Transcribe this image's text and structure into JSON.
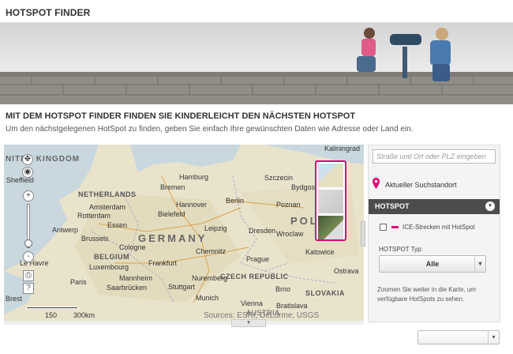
{
  "page": {
    "title": "HOTSPOT FINDER",
    "heading": "MIT DEM HOTSPOT FINDER FINDEN SIE KINDERLEICHT DEN NÄCHSTEN HOTSPOT",
    "subheading": "Um den nächstgelegenen HotSpot zu finden, geben Sie einfach Ihre gewünschten Daten wie Adresse oder Land ein."
  },
  "map": {
    "countries": [
      "NITED KINGDOM",
      "NETHERLANDS",
      "GERMANY",
      "POLA",
      "BELGIUM",
      "CZECH REPUBLIC",
      "SLOVAKIA",
      "AUSTRIA"
    ],
    "cities": [
      "Kaliningrad",
      "Hamburg",
      "Szczecin",
      "Bydgoszcz",
      "Bremen",
      "Berlin",
      "Poznan",
      "Hannover",
      "Amsterdam",
      "Bielefeld",
      "Rotterdam",
      "Leipzig",
      "Dresden",
      "Wroclaw",
      "Antwerp",
      "Essen",
      "Brussels",
      "Cologne",
      "Frankfurt",
      "Chemnitz",
      "Prague",
      "Katowice",
      "Mannheim",
      "Nuremberg",
      "Paris",
      "Saarbrücken",
      "Stuttgart",
      "Brno",
      "Munich",
      "Vienna",
      "Bratislava",
      "Sheffield",
      "Ostrava",
      "Luxembourg",
      "Le Havre",
      "Brest"
    ],
    "scale": {
      "a": "150",
      "b": "300km"
    },
    "attribution": "Sources: ESRI, DeLorme, USGS",
    "zoom_in": "+",
    "zoom_out": "-",
    "help": "?",
    "print": "⎙",
    "handle_icon": "▾"
  },
  "panel": {
    "search_placeholder": "Straße und Ort oder PLZ eingeben",
    "current_location": "Aktueller Suchstandort",
    "hotspot_header": "HOTSPOT",
    "collapse_icon": "▾",
    "ice_label": "ICE-Strecken mit HotSpot",
    "typ_label": "HOTSPOT Typ:",
    "typ_value": "Alle",
    "hint": "Zoomen Sie weiter in die Karte, um verfügbare HotSpots zu sehen.",
    "select_arrow": "▾"
  },
  "colors": {
    "accent": "#e20074",
    "header_dark": "#4c4c4c"
  }
}
